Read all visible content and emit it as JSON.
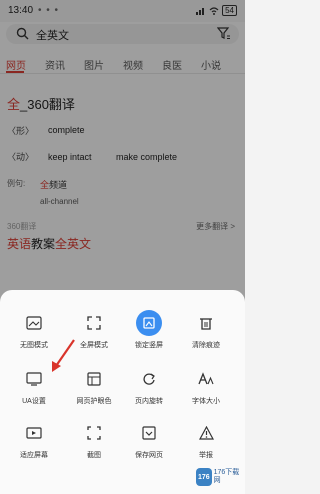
{
  "status": {
    "time": "13:40",
    "dots": "• • •",
    "battery": "54"
  },
  "search": {
    "query": "全英文"
  },
  "tabs": [
    {
      "label": "网页"
    },
    {
      "label": "资讯"
    },
    {
      "label": "图片"
    },
    {
      "label": "视频"
    },
    {
      "label": "良医"
    },
    {
      "label": "小说"
    }
  ],
  "result": {
    "title_hl": "全",
    "title_rest": "_360翻译",
    "adj_pos": "〈形〉",
    "adj_word": "complete",
    "verb_pos": "〈动〉",
    "verb_word1": "keep intact",
    "verb_word2": "make complete",
    "example_label": "例句:",
    "example_hl": "全",
    "example_rest": "频道",
    "example_trans": "all-channel",
    "source": "360翻译",
    "more": "更多翻译 >"
  },
  "result2": {
    "part1": "英语",
    "part2": "教案",
    "part3": "全英文"
  },
  "menu": {
    "row1": [
      {
        "icon": "no-image-icon",
        "label": "无图模式",
        "selected": false
      },
      {
        "icon": "fullscreen-icon",
        "label": "全屏模式",
        "selected": false
      },
      {
        "icon": "lock-screen-icon",
        "label": "锁定竖屏",
        "selected": true
      },
      {
        "icon": "trash-icon",
        "label": "清除痕迹",
        "selected": false
      }
    ],
    "row2": [
      {
        "icon": "ua-icon",
        "label": "UA设置",
        "selected": false
      },
      {
        "icon": "eye-care-icon",
        "label": "网页护眼色",
        "selected": false
      },
      {
        "icon": "rotate-icon",
        "label": "页内旋转",
        "selected": false
      },
      {
        "icon": "font-size-icon",
        "label": "字体大小",
        "selected": false
      }
    ],
    "row3": [
      {
        "icon": "video-screen-icon",
        "label": "适应屏幕",
        "selected": false
      },
      {
        "icon": "screenshot-icon",
        "label": "截图",
        "selected": false
      },
      {
        "icon": "save-page-icon",
        "label": "保存网页",
        "selected": false
      },
      {
        "icon": "report-icon",
        "label": "举报",
        "selected": false
      }
    ]
  },
  "watermark": {
    "logo": "176",
    "text": "176下载网"
  },
  "colors": {
    "accent": "#d43c33",
    "selected": "#3b8ef0",
    "arrow": "#d9342b"
  }
}
